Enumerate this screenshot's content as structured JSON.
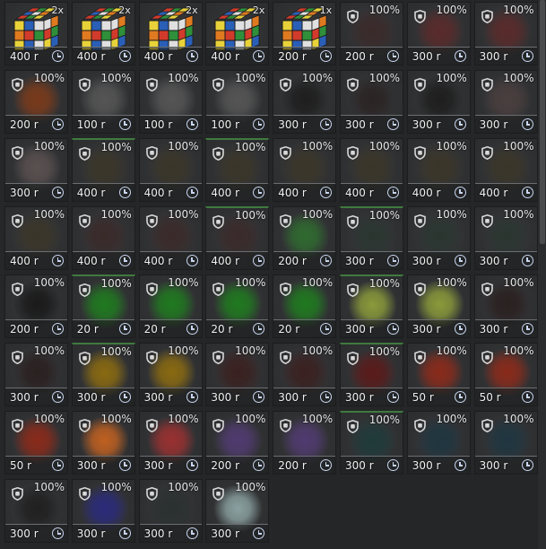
{
  "colors": {
    "accent_clock": "#c8d6f0",
    "rarity_green": "#3f7a3f"
  },
  "items": [
    {
      "kind": "cube",
      "stack": "2x",
      "price": "400 r",
      "color": "#c07040"
    },
    {
      "kind": "cube",
      "stack": "2x",
      "price": "400 r",
      "color": "#c07040"
    },
    {
      "kind": "cube",
      "stack": "2x",
      "price": "400 r",
      "color": "#c07040"
    },
    {
      "kind": "cube",
      "stack": "2x",
      "price": "400 r",
      "color": "#c07040"
    },
    {
      "kind": "cube",
      "stack": "1x",
      "price": "200 r",
      "color": "#c07040"
    },
    {
      "kind": "item",
      "pct": "100%",
      "price": "200 r",
      "color": "#3a2a2a"
    },
    {
      "kind": "item",
      "pct": "100%",
      "price": "300 r",
      "color": "#5a2a2a"
    },
    {
      "kind": "item",
      "pct": "100%",
      "price": "300 r",
      "color": "#5a2a2a"
    },
    {
      "kind": "item",
      "pct": "100%",
      "price": "200 r",
      "color": "#7a3a1a"
    },
    {
      "kind": "item",
      "pct": "100%",
      "price": "100 r",
      "color": "#555555"
    },
    {
      "kind": "item",
      "pct": "100%",
      "price": "100 r",
      "color": "#555555"
    },
    {
      "kind": "item",
      "pct": "100%",
      "price": "100 r",
      "color": "#555555"
    },
    {
      "kind": "item",
      "pct": "100%",
      "price": "300 r",
      "color": "#1e1e1e"
    },
    {
      "kind": "item",
      "pct": "100%",
      "price": "300 r",
      "color": "#2a2424"
    },
    {
      "kind": "item",
      "pct": "100%",
      "price": "300 r",
      "color": "#1e1e1e"
    },
    {
      "kind": "item",
      "pct": "100%",
      "price": "300 r",
      "color": "#4a3e3e"
    },
    {
      "kind": "item",
      "pct": "100%",
      "price": "300 r",
      "color": "#5a5050"
    },
    {
      "kind": "item",
      "pct": "100%",
      "price": "400 r",
      "color": "#3a3528",
      "green": true
    },
    {
      "kind": "item",
      "pct": "100%",
      "price": "400 r",
      "color": "#3a3528"
    },
    {
      "kind": "item",
      "pct": "100%",
      "price": "400 r",
      "color": "#3a3528",
      "green": true
    },
    {
      "kind": "item",
      "pct": "100%",
      "price": "400 r",
      "color": "#3a3528"
    },
    {
      "kind": "item",
      "pct": "100%",
      "price": "400 r",
      "color": "#3a3528"
    },
    {
      "kind": "item",
      "pct": "100%",
      "price": "400 r",
      "color": "#3a3528"
    },
    {
      "kind": "item",
      "pct": "100%",
      "price": "400 r",
      "color": "#3a3528"
    },
    {
      "kind": "item",
      "pct": "100%",
      "price": "400 r",
      "color": "#3a3528"
    },
    {
      "kind": "item",
      "pct": "100%",
      "price": "400 r",
      "color": "#3a2a2a"
    },
    {
      "kind": "item",
      "pct": "100%",
      "price": "400 r",
      "color": "#3a2a2a"
    },
    {
      "kind": "item",
      "pct": "100%",
      "price": "400 r",
      "color": "#3a2a2a",
      "green": true
    },
    {
      "kind": "item",
      "pct": "100%",
      "price": "200 r",
      "color": "#2f6a2f"
    },
    {
      "kind": "item",
      "pct": "100%",
      "price": "300 r",
      "color": "#2a3530",
      "green": true
    },
    {
      "kind": "item",
      "pct": "100%",
      "price": "300 r",
      "color": "#2a3530"
    },
    {
      "kind": "item",
      "pct": "100%",
      "price": "300 r",
      "color": "#2a3530"
    },
    {
      "kind": "item",
      "pct": "100%",
      "price": "200 r",
      "color": "#1a1a1a"
    },
    {
      "kind": "item",
      "pct": "100%",
      "price": "20 r",
      "color": "#1f7a1f",
      "green": true
    },
    {
      "kind": "item",
      "pct": "100%",
      "price": "20 r",
      "color": "#1f7a1f"
    },
    {
      "kind": "item",
      "pct": "100%",
      "price": "20 r",
      "color": "#1f7a1f"
    },
    {
      "kind": "item",
      "pct": "100%",
      "price": "20 r",
      "color": "#1f7a1f"
    },
    {
      "kind": "item",
      "pct": "100%",
      "price": "300 r",
      "color": "#8a9a3a",
      "green": true
    },
    {
      "kind": "item",
      "pct": "100%",
      "price": "300 r",
      "color": "#8a9a3a"
    },
    {
      "kind": "item",
      "pct": "100%",
      "price": "300 r",
      "color": "#2a2020"
    },
    {
      "kind": "item",
      "pct": "100%",
      "price": "300 r",
      "color": "#2a2020"
    },
    {
      "kind": "item",
      "pct": "100%",
      "price": "300 r",
      "color": "#8a6a10",
      "green": true
    },
    {
      "kind": "item",
      "pct": "100%",
      "price": "300 r",
      "color": "#8a6a10"
    },
    {
      "kind": "item",
      "pct": "100%",
      "price": "300 r",
      "color": "#3a2020"
    },
    {
      "kind": "item",
      "pct": "100%",
      "price": "300 r",
      "color": "#3a2020"
    },
    {
      "kind": "item",
      "pct": "100%",
      "price": "300 r",
      "color": "#5a1a1a",
      "green": true
    },
    {
      "kind": "item",
      "pct": "100%",
      "price": "50 r",
      "color": "#8a2a1a"
    },
    {
      "kind": "item",
      "pct": "100%",
      "price": "50 r",
      "color": "#8a2a1a"
    },
    {
      "kind": "item",
      "pct": "100%",
      "price": "50 r",
      "color": "#8a2a1a"
    },
    {
      "kind": "item",
      "pct": "100%",
      "price": "300 r",
      "color": "#c06020"
    },
    {
      "kind": "item",
      "pct": "100%",
      "price": "300 r",
      "color": "#9a3030"
    },
    {
      "kind": "item",
      "pct": "100%",
      "price": "200 r",
      "color": "#503a70"
    },
    {
      "kind": "item",
      "pct": "100%",
      "price": "200 r",
      "color": "#503a70"
    },
    {
      "kind": "item",
      "pct": "100%",
      "price": "300 r",
      "color": "#1f3a3a",
      "green": true
    },
    {
      "kind": "item",
      "pct": "100%",
      "price": "300 r",
      "color": "#1f3540"
    },
    {
      "kind": "item",
      "pct": "100%",
      "price": "300 r",
      "color": "#1f3540"
    },
    {
      "kind": "item",
      "pct": "100%",
      "price": "300 r",
      "color": "#202020"
    },
    {
      "kind": "item",
      "pct": "100%",
      "price": "300 r",
      "color": "#2a2a7a"
    },
    {
      "kind": "item",
      "pct": "100%",
      "price": "300 r",
      "color": "#2a3030"
    },
    {
      "kind": "item",
      "pct": "100%",
      "price": "300 r",
      "color": "#8aa0a0"
    }
  ]
}
